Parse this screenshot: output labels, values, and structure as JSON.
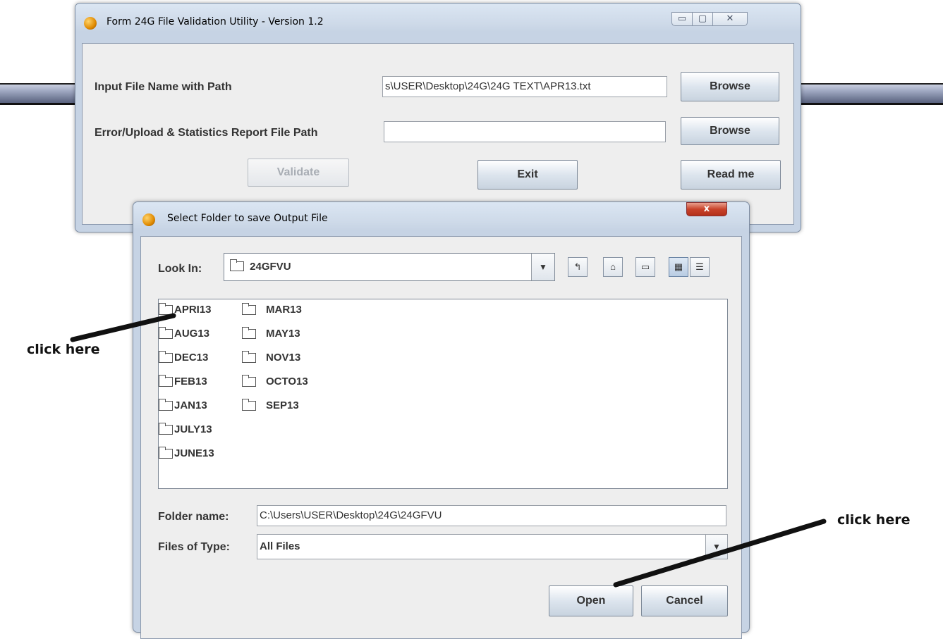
{
  "main_window": {
    "title": "Form 24G File Validation Utility - Version 1.2",
    "caption_buttons": {
      "minimize": "▭",
      "maximize": "▢",
      "close": "✕"
    },
    "input_label": "Input File Name with Path",
    "input_value": "s\\USER\\Desktop\\24G\\24G TEXT\\APR13.txt",
    "browse_label": "Browse",
    "report_label": "Error/Upload & Statistics Report File Path",
    "report_value": "",
    "browse2_label": "Browse",
    "validate_label": "Validate",
    "exit_label": "Exit",
    "readme_label": "Read me"
  },
  "dialog": {
    "title": "Select Folder to save Output File",
    "close_glyph": "x",
    "look_in_label": "Look In:",
    "look_in_value": "24GFVU",
    "toolbar_icons": [
      "up-folder-icon",
      "home-icon",
      "new-folder-icon",
      "list-view-icon",
      "details-view-icon"
    ],
    "folders_col1": [
      "APRI13",
      "AUG13",
      "DEC13",
      "FEB13",
      "JAN13",
      "JULY13",
      "JUNE13"
    ],
    "folders_col2": [
      "MAR13",
      "MAY13",
      "NOV13",
      "OCTO13",
      "SEP13"
    ],
    "folder_name_label": "Folder name:",
    "folder_name_value": "C:\\Users\\USER\\Desktop\\24G\\24GFVU",
    "files_type_label": "Files of Type:",
    "files_type_value": "All Files",
    "open_label": "Open",
    "cancel_label": "Cancel"
  },
  "annotations": {
    "left": "click here",
    "right": "click here"
  },
  "colors": {
    "annotation_arrow": "#111111",
    "title_bar": "#cdd9e8",
    "close_button": "#c8422a"
  }
}
